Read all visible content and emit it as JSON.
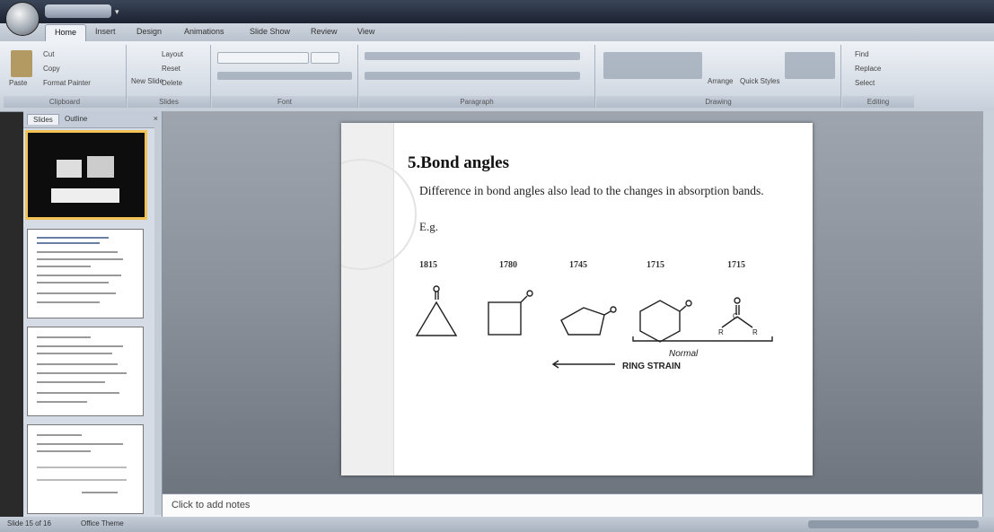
{
  "window": {
    "title": ""
  },
  "ribbon": {
    "tabs": [
      "Home",
      "Insert",
      "Design",
      "Animations",
      "Slide Show",
      "Review",
      "View"
    ],
    "active_tab": "Home",
    "groups": [
      "Clipboard",
      "Slides",
      "Font",
      "Paragraph",
      "Drawing",
      "Editing"
    ],
    "clipboard": {
      "paste": "Paste",
      "cut": "Cut",
      "copy": "Copy",
      "format_painter": "Format Painter"
    },
    "slides": {
      "new_slide": "New Slide",
      "layout": "Layout",
      "reset": "Reset",
      "delete": "Delete"
    },
    "drawing": {
      "arrange": "Arrange",
      "quick_styles": "Quick Styles"
    },
    "editing": {
      "find": "Find",
      "replace": "Replace",
      "select": "Select"
    }
  },
  "left_pane": {
    "tabs": [
      "Slides",
      "Outline"
    ],
    "thumbnails": [
      "",
      "",
      "",
      ""
    ]
  },
  "slide": {
    "title": "5.Bond angles",
    "body": "Difference in bond angles also lead to the changes in absorption bands.",
    "eg": "E.g.",
    "frequencies": [
      "1815",
      "1780",
      "1745",
      "1715",
      "1715"
    ],
    "normal_label": "Normal",
    "strain_label": "RING STRAIN"
  },
  "notes": {
    "placeholder": "Click to add notes"
  },
  "status": {
    "slide_info": "Slide 15 of 16",
    "theme": "Office Theme"
  }
}
